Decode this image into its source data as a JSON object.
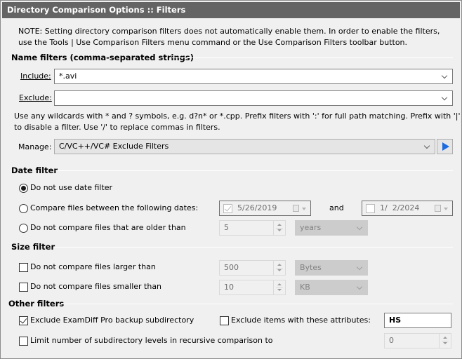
{
  "title": "Directory Comparison Options :: Filters",
  "note": "NOTE: Setting directory comparison filters does not automatically enable them. In order to enable the filters, use the Tools | Use Comparison Filters menu command or the Use Comparison Filters toolbar button.",
  "name_filters": {
    "heading": "Name filters (comma-separated strings)",
    "include_label": "Include:",
    "include_value": "*.avi",
    "exclude_label": "Exclude:",
    "exclude_value": "",
    "help_line1": "Use any wildcards with * and ? symbols, e.g. d?n* or *.cpp. Prefix filters with ':' for full path matching. Prefix with '|'",
    "help_line2": "to disable a filter. Use '/' to replace commas in filters.",
    "manage_label": "Manage:",
    "manage_value": "C/VC++/VC# Exclude Filters",
    "run_icon": "play-icon"
  },
  "date_filter": {
    "heading": "Date filter",
    "options": [
      {
        "label": "Do not use date filter",
        "selected": true
      },
      {
        "label": "Compare files between the following dates:",
        "selected": false
      },
      {
        "label": "Do not compare files that are older than",
        "selected": false
      }
    ],
    "from_date": {
      "checked": true,
      "value": "5/26/2019"
    },
    "and_label": "and",
    "to_date": {
      "checked": false,
      "value": "1/  2/2024"
    },
    "older_than_value": "5",
    "older_than_unit": "years"
  },
  "size_filter": {
    "heading": "Size filter",
    "larger": {
      "label": "Do not compare files larger than",
      "checked": false,
      "value": "500",
      "unit": "Bytes"
    },
    "smaller": {
      "label": "Do not compare files smaller than",
      "checked": false,
      "value": "10",
      "unit": "KB"
    }
  },
  "other_filters": {
    "heading": "Other filters",
    "exclude_backup": {
      "label": "Exclude ExamDiff Pro backup subdirectory",
      "checked": true
    },
    "exclude_attrs": {
      "label": "Exclude items with these attributes:",
      "checked": false,
      "value": "HS"
    },
    "limit_levels": {
      "label": "Limit number of subdirectory levels in recursive comparison to",
      "checked": false,
      "value": "0"
    }
  }
}
